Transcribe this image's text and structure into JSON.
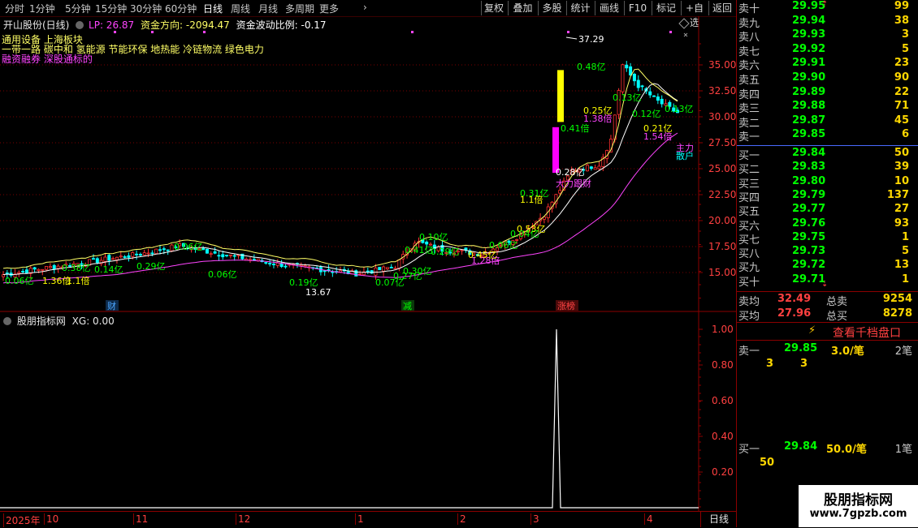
{
  "toolbar": {
    "periods": [
      "分时",
      "1分钟",
      "5分钟",
      "15分钟",
      "30分钟",
      "60分钟",
      "日线",
      "周线",
      "月线",
      "多周期",
      "更多"
    ],
    "active_period": "日线",
    "buttons": [
      "复权",
      "叠加",
      "多股",
      "统计",
      "画线",
      "F10",
      "标记",
      "+自选",
      "返回"
    ]
  },
  "main": {
    "stock_title": "开山股份(日线)",
    "lp_label": "LP: 26.87",
    "fund_dir": "资金方向: -2094.47",
    "fund_vol": "资金波动比例: -0.17",
    "concepts": [
      "通用设备 上海板块",
      "一带一路 碳中和 氢能源 节能环保 地热能 冷链物流 绿色电力",
      "融资融券 深股通标的"
    ],
    "price_axis": [
      "35.00",
      "32.50",
      "30.00",
      "27.50",
      "25.00",
      "22.50",
      "20.00",
      "17.50",
      "15.00"
    ],
    "annotations": [
      {
        "t": "0.06亿",
        "c": "#00ff00"
      },
      {
        "t": "1.36倍",
        "c": "#ffff00"
      },
      {
        "t": "0.38亿",
        "c": "#00ff00"
      },
      {
        "t": "0.14亿",
        "c": "#00ff00"
      },
      {
        "t": "1.1倍",
        "c": "#ffff00"
      },
      {
        "t": "0.29亿",
        "c": "#00ff00"
      },
      {
        "t": "0.06亿",
        "c": "#00ff00"
      },
      {
        "t": "0.06亿",
        "c": "#00ff00"
      },
      {
        "t": "0.19亿",
        "c": "#00ff00"
      },
      {
        "t": "13.67",
        "c": "#ffffff"
      },
      {
        "t": "0.07亿",
        "c": "#00ff00"
      },
      {
        "t": "0.27亿",
        "c": "#00ff00"
      },
      {
        "t": "0.30亿",
        "c": "#00ff00"
      },
      {
        "t": "0.10亿",
        "c": "#00ff00"
      },
      {
        "t": "0.41亿",
        "c": "#00ff00"
      },
      {
        "t": "0.29亿",
        "c": "#00ff00"
      },
      {
        "t": "1.28倍",
        "c": "#ff44ff"
      },
      {
        "t": "0.45亿",
        "c": "#ffff00"
      },
      {
        "t": "0.06亿",
        "c": "#00ff00"
      },
      {
        "t": "0.53亿",
        "c": "#ffff00"
      },
      {
        "t": "0.04亿",
        "c": "#00ff00"
      },
      {
        "t": "0.31亿",
        "c": "#00ff00"
      },
      {
        "t": "1.1倍",
        "c": "#ffff00"
      },
      {
        "t": "0.28亿",
        "c": "#ffffff"
      },
      {
        "t": "大力跟财",
        "c": "#ff44ff"
      },
      {
        "t": "0.41倍",
        "c": "#00ff00"
      },
      {
        "t": "37.29",
        "c": "#ffffff"
      },
      {
        "t": "0.48亿",
        "c": "#00ff00"
      },
      {
        "t": "0.13亿",
        "c": "#00ff00"
      },
      {
        "t": "0.25亿",
        "c": "#ffff00"
      },
      {
        "t": "1.38倍",
        "c": "#ff44ff"
      },
      {
        "t": "0.12亿",
        "c": "#00ff00"
      },
      {
        "t": "0.21亿",
        "c": "#ffff00"
      },
      {
        "t": "1.54倍",
        "c": "#ff44ff"
      },
      {
        "t": "0.13亿",
        "c": "#00ff00"
      },
      {
        "t": "主力",
        "c": "#ff44ff"
      },
      {
        "t": "散户",
        "c": "#00ffff"
      }
    ],
    "markers": [
      {
        "t": "财",
        "c": "#4da6ff"
      },
      {
        "t": "减",
        "c": "#00ff00"
      },
      {
        "t": "涨榜",
        "c": "#ff4444"
      }
    ]
  },
  "indicator": {
    "title": "股朋指标网",
    "xg_label": "XG: 0.00",
    "axis": [
      "1.00",
      "0.80",
      "0.60",
      "0.40",
      "0.20"
    ],
    "signal_value": 1.0
  },
  "time_axis": [
    "2025年",
    "10",
    "11",
    "12",
    "1",
    "2",
    "3",
    "4"
  ],
  "period_tab": "日线",
  "order_book": {
    "asks": [
      {
        "label": "卖十",
        "price": "29.95",
        "vol": "99"
      },
      {
        "label": "卖九",
        "price": "29.94",
        "vol": "38"
      },
      {
        "label": "卖八",
        "price": "29.93",
        "vol": "3"
      },
      {
        "label": "卖七",
        "price": "29.92",
        "vol": "5"
      },
      {
        "label": "卖六",
        "price": "29.91",
        "vol": "23"
      },
      {
        "label": "卖五",
        "price": "29.90",
        "vol": "90"
      },
      {
        "label": "卖四",
        "price": "29.89",
        "vol": "22"
      },
      {
        "label": "卖三",
        "price": "29.88",
        "vol": "71"
      },
      {
        "label": "卖二",
        "price": "29.87",
        "vol": "45"
      },
      {
        "label": "卖一",
        "price": "29.85",
        "vol": "6"
      }
    ],
    "bids": [
      {
        "label": "买一",
        "price": "29.84",
        "vol": "50"
      },
      {
        "label": "买二",
        "price": "29.83",
        "vol": "39"
      },
      {
        "label": "买三",
        "price": "29.80",
        "vol": "10"
      },
      {
        "label": "买四",
        "price": "29.79",
        "vol": "137"
      },
      {
        "label": "买五",
        "price": "29.77",
        "vol": "27"
      },
      {
        "label": "买六",
        "price": "29.76",
        "vol": "93"
      },
      {
        "label": "买七",
        "price": "29.75",
        "vol": "1"
      },
      {
        "label": "买八",
        "price": "29.73",
        "vol": "5"
      },
      {
        "label": "买九",
        "price": "29.72",
        "vol": "13"
      },
      {
        "label": "买十",
        "price": "29.71",
        "vol": "1"
      }
    ],
    "ask_avg_label": "卖均",
    "ask_avg": "32.49",
    "total_ask_label": "总卖",
    "total_ask": "9254",
    "bid_avg_label": "买均",
    "bid_avg": "27.96",
    "total_bid_label": "总买",
    "total_bid": "8278",
    "qiandang_button": "查看千档盘口",
    "sell1": {
      "label": "卖一",
      "price": "29.85",
      "per": "3.0/笔",
      "count": "2笔",
      "q1": "3",
      "q2": "3"
    },
    "buy1": {
      "label": "买一",
      "price": "29.84",
      "per": "50.0/笔",
      "count": "1笔",
      "q1": "50"
    }
  },
  "watermark": {
    "name": "股朋指标网",
    "url": "www.7gpzb.com"
  },
  "colors": {
    "up": "#ff3030",
    "down": "#00ffff",
    "ma_yellow": "#ffff66",
    "ma_white": "#ffffff",
    "ma_magenta": "#ff44ff",
    "border": "#8b0000"
  }
}
